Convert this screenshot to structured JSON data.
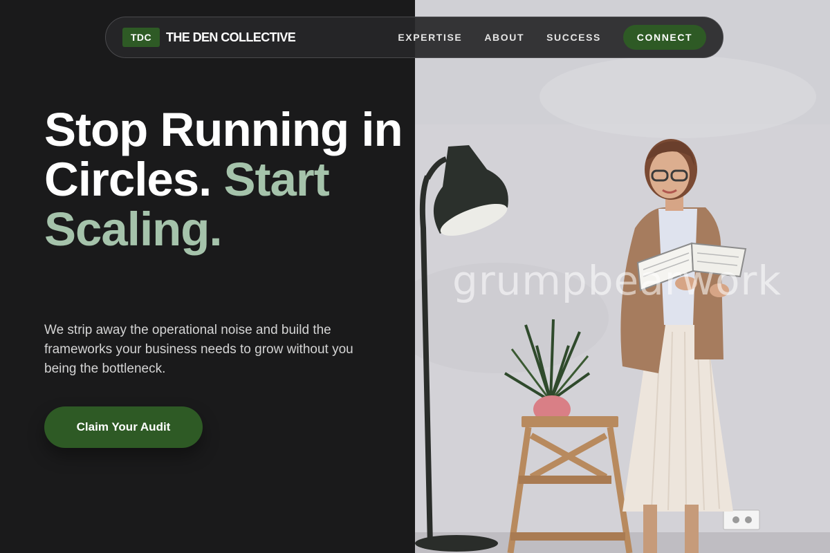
{
  "nav": {
    "logo_badge": "TDC",
    "brand_name": "THE DEN COLLECTIVE",
    "links": [
      "EXPERTISE",
      "ABOUT",
      "SUCCESS"
    ],
    "cta": "CONNECT"
  },
  "hero": {
    "headline_white": "Stop Running in Circles.",
    "headline_accent": "Start Scaling.",
    "subcopy": "We strip away the operational noise and build the frameworks your business needs to grow without you being the bottleneck.",
    "cta": "Claim Your Audit",
    "photo_watermark": "grumpbearwork"
  },
  "colors": {
    "background": "#1a1a1b",
    "brand_green": "#2e5a25",
    "accent_text": "#a5c3ab",
    "nav_background": "#262628"
  },
  "icons": {
    "logo": "tdc-logo-badge"
  }
}
